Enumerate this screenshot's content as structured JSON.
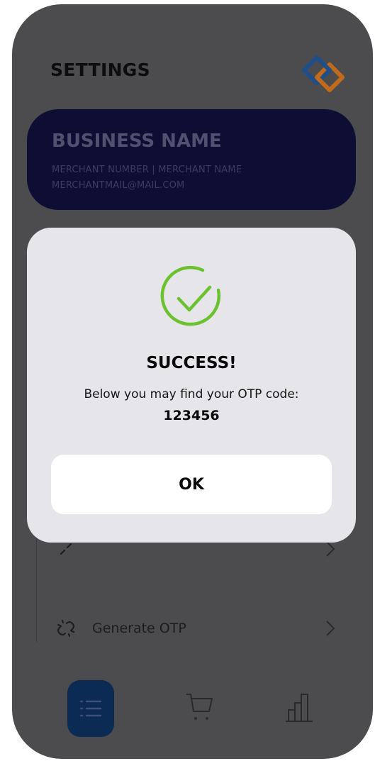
{
  "header": {
    "title": "SETTINGS",
    "logo_icon": "diamond-logo-icon"
  },
  "business_card": {
    "name": "BUSINESS NAME",
    "merchant_line": "MERCHANT NUMBER | MERCHANT NAME",
    "email": "MERCHANTMAIL@MAIL.COM"
  },
  "settings_list": {
    "items": [
      {
        "label": "",
        "icon": "link-icon"
      },
      {
        "label": "Generate OTP",
        "icon": "broken-link-icon"
      }
    ]
  },
  "modal": {
    "title": "SUCCESS!",
    "message": "Below you may find your OTP code:",
    "code": "123456",
    "ok_label": "OK",
    "icon": "check-circle-icon"
  },
  "tabbar": {
    "tabs": [
      {
        "icon": "list-icon",
        "active": true
      },
      {
        "icon": "cart-icon",
        "active": false
      },
      {
        "icon": "bar-chart-icon",
        "active": false
      }
    ]
  },
  "colors": {
    "overlay_background": "#4c4c4e",
    "business_card": "#0e0d34",
    "modal_background": "#e6e6ea",
    "success_green": "#6cc22e",
    "active_tab": "#0b2a54",
    "logo_blue": "#1f4e8a",
    "logo_orange": "#c26a1b"
  }
}
